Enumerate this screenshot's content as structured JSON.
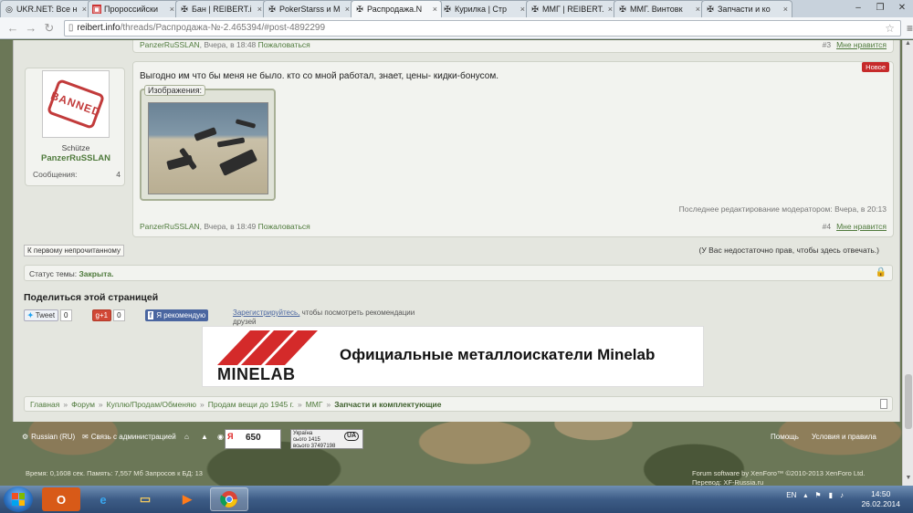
{
  "browser": {
    "tabs": [
      {
        "label": "UKR.NET: Все н",
        "icon": "globe-icon",
        "active": false
      },
      {
        "label": "Пророссийски",
        "icon": "news-icon",
        "active": false
      },
      {
        "label": "Бан | REIBERT.i",
        "icon": "iron-cross-icon",
        "active": false
      },
      {
        "label": "PokerStarss и М",
        "icon": "iron-cross-icon",
        "active": false
      },
      {
        "label": "Распродажа.N",
        "icon": "iron-cross-icon",
        "active": true
      },
      {
        "label": "Курилка | Стр",
        "icon": "iron-cross-icon",
        "active": false
      },
      {
        "label": "ММГ | REIBERT.",
        "icon": "iron-cross-icon",
        "active": false
      },
      {
        "label": "ММГ. Винтовк",
        "icon": "iron-cross-icon",
        "active": false
      },
      {
        "label": "Запчасти и ко",
        "icon": "iron-cross-icon",
        "active": false
      }
    ],
    "close_glyph": "×",
    "window_controls": [
      "–",
      "❐",
      "✕"
    ],
    "url_domain": "reibert.info",
    "url_path": "/threads/Распродажа-№-2.465394/#post-4892299"
  },
  "post_prev": {
    "author": "PanzerRuSSLAN",
    "date": "Вчера, в 18:48",
    "report": "Пожаловаться",
    "number": "#3",
    "like": "Мне нравится"
  },
  "user": {
    "avatar_text": "BANNED",
    "title": "Schütze",
    "name": "PanzerRuSSLAN",
    "messages_label": "Сообщения:",
    "messages_count": "4"
  },
  "post": {
    "badge": "Новое",
    "text": "Выгодно им что бы меня не было. кто со мной работал, знает, цены- кидки-бонусом.",
    "attachments_label": "Изображения:",
    "edit_note": "Последнее редактирование модератором: Вчера, в 20:13",
    "author": "PanzerRuSSLAN",
    "date": "Вчера, в 18:49",
    "report": "Пожаловаться",
    "number": "#4",
    "like": "Мне нравится"
  },
  "thread": {
    "first_unread": "К первому непрочитанному",
    "no_permission": "(У Вас недостаточно прав, чтобы здесь отвечать.)",
    "status_label": "Статус темы:",
    "status_value": "Закрыта."
  },
  "share": {
    "title": "Поделиться этой страницей",
    "tweet": "Tweet",
    "tweet_count": "0",
    "gplus": "+1",
    "gplus_count": "0",
    "fb_logo": "f",
    "fb_recommend": "Я рекомендую",
    "fb_register": "Зарегистрируйтесь,",
    "fb_text": " чтобы посмотреть рекомендации друзей"
  },
  "banner": {
    "brand": "MINELAB",
    "text": "Официальные металлоискатели Minelab"
  },
  "breadcrumb": {
    "items": [
      "Главная",
      "Форум",
      "Куплю/Продам/Обменяю",
      "Продам вещи до 1945 г.",
      "ММГ"
    ],
    "current": "Запчасти и комплектующие"
  },
  "footer": {
    "language": "Russian (RU)",
    "contact": "Связь с администрацией",
    "counter_y": "Я",
    "counter_value": "650",
    "counter2_lines": [
      "Україна",
      "сього",
      "всього"
    ],
    "counter2_values": [
      "1415",
      "37497198"
    ],
    "counter2_ua": "UA",
    "help": "Помощь",
    "terms": "Условия и правила",
    "stats": "Время: 0,1608 сек. Память: 7,557 Мб Запросов к БД: 13",
    "software": "Forum software by XenForo™ ©2010-2013 XenForo Ltd.",
    "translation": "Перевод: XF-Russia.ru"
  },
  "taskbar": {
    "lang": "EN",
    "time": "14:50",
    "date": "26.02.2014"
  }
}
